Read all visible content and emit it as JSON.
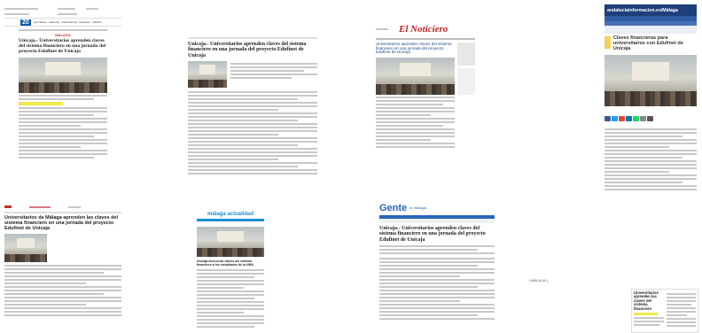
{
  "clips": {
    "c1": {
      "brand": "20",
      "topnav": "Las Claves · Nacional · Internacional · Deportes · Opinión",
      "section": "MALAGA",
      "headline": "Unicaja.- Universitarios aprenden claves del sistema financiero en una jornada del proyecto Eduflnet de Unicaja"
    },
    "c2": {
      "headline": "Unicaja.- Universitarios aprenden claves del sistema financiero en una jornada del proyecto Edufinet de Unicaja"
    },
    "c3": {
      "logo": "El Noticiero",
      "headline": "Universitarios aprenden claves del sistema financiero en una jornada del proyecto Edufinet de Unicaja"
    },
    "c4": {
      "brand": "andaluciainformacion.es/Málaga",
      "headline": "Claves financieras para universitarios con Edufinet de Unicaja"
    },
    "c5": {
      "headline": "Universitarios de Málaga aprenden las claves del sistema financiero en una jornada del proyecto Edufinet de Unicaja"
    },
    "c6": {
      "logo": "málaga actualidad",
      "headline": "Unicaja acerca las claves del sistema financiero a los estudiantes de la UMA"
    },
    "c7": {
      "logo": "Gente",
      "subbrand": "en Málaga",
      "headline": "Unicaja.- Universitarios aprenden claves del sistema financiero en una jornada del proyecto Edufinet de Unicaja"
    },
    "c8": {
      "tag": "| MÁLAGA |"
    },
    "c9": {
      "headline": "Universitarios aprenden las claves del sistema financiero"
    }
  },
  "colors": {
    "brand20": "#0b5aa8",
    "andalucia": "#1d3f7a",
    "gente": "#2a66b8",
    "malagaActualidad": "#1a8fd8",
    "noticiero": "#c21f26",
    "section": "#c03030"
  }
}
